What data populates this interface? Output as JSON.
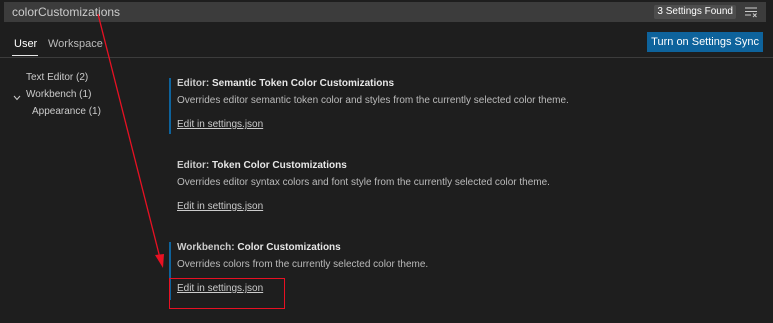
{
  "search": {
    "value": "colorCustomizations",
    "found_badge": "3 Settings Found",
    "filter_icon": "clear-filter-icon"
  },
  "tabs": {
    "user": "User",
    "workspace": "Workspace"
  },
  "sync_button": "Turn on Settings Sync",
  "toc": {
    "text_editor": "Text Editor (2)",
    "workbench": "Workbench (1)",
    "appearance": "Appearance (1)"
  },
  "settings": [
    {
      "category": "Editor: ",
      "name": "Semantic Token Color Customizations",
      "description": "Overrides editor semantic token color and styles from the currently selected color theme.",
      "link": "Edit in settings.json"
    },
    {
      "category": "Editor: ",
      "name": "Token Color Customizations",
      "description": "Overrides editor syntax colors and font style from the currently selected color theme.",
      "link": "Edit in settings.json"
    },
    {
      "category": "Workbench: ",
      "name": "Color Customizations",
      "description": "Overrides colors from the currently selected color theme.",
      "link": "Edit in settings.json"
    }
  ],
  "colors": {
    "background": "#1e1e1e",
    "accent_button": "#0e639c",
    "annotation": "#e81123"
  }
}
